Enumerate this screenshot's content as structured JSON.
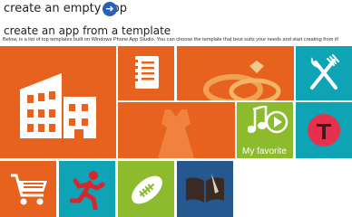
{
  "header": {
    "create_empty_label": "create an empty app",
    "empty_arrow_icon": "arrow-right-circle-icon",
    "template_heading": "create an app from a template",
    "template_description": "Below, is a list of top templates built on Windows Phone App Studio. You can choose the template that best suits your needs and start creating from it!"
  },
  "tiles": [
    {
      "id": "company",
      "icon": "building-icon",
      "color": "#e8621f"
    },
    {
      "id": "notebook",
      "icon": "notebook-icon",
      "color": "#e8621f"
    },
    {
      "id": "wedding",
      "icon": "rings-icon",
      "color": "#e8621f"
    },
    {
      "id": "restaurant",
      "icon": "fork-knife-icon",
      "color": "#0ea3b5"
    },
    {
      "id": "fashion",
      "icon": "dress-icon",
      "color": "#e8621f"
    },
    {
      "id": "my-favorite",
      "icon": "music-video-icon",
      "color": "#8dbb2e",
      "label": "My favorite"
    },
    {
      "id": "typography",
      "icon": "letter-t-icon",
      "color": "#0ea3b5"
    },
    {
      "id": "shopping",
      "icon": "shopping-cart-icon",
      "color": "#e8621f"
    },
    {
      "id": "sports-runner",
      "icon": "runner-icon",
      "color": "#0ea3b5"
    },
    {
      "id": "football",
      "icon": "football-icon",
      "color": "#8dbb2e"
    },
    {
      "id": "reading",
      "icon": "book-pen-icon",
      "color": "#24588e"
    }
  ]
}
